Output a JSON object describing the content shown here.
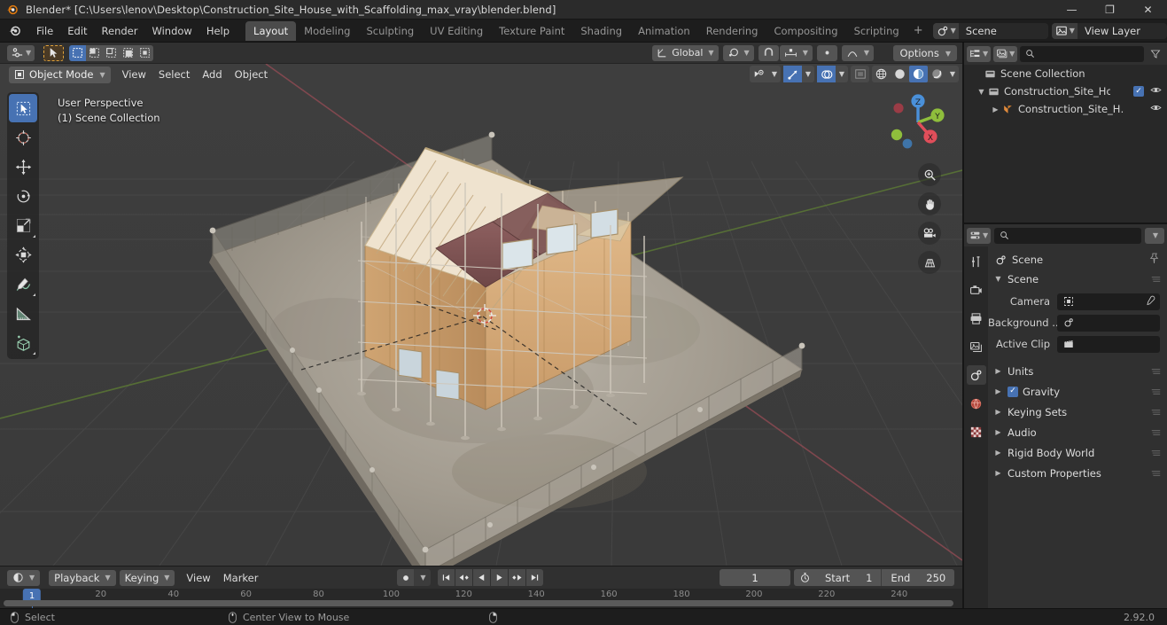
{
  "window": {
    "title": "Blender* [C:\\Users\\lenov\\Desktop\\Construction_Site_House_with_Scaffolding_max_vray\\blender.blend]",
    "minimize": "—",
    "maximize": "❐",
    "close": "✕"
  },
  "topbar": {
    "menus": [
      "File",
      "Edit",
      "Render",
      "Window",
      "Help"
    ],
    "workspaces": [
      {
        "label": "Layout",
        "active": true
      },
      {
        "label": "Modeling",
        "active": false
      },
      {
        "label": "Sculpting",
        "active": false
      },
      {
        "label": "UV Editing",
        "active": false
      },
      {
        "label": "Texture Paint",
        "active": false
      },
      {
        "label": "Shading",
        "active": false
      },
      {
        "label": "Animation",
        "active": false
      },
      {
        "label": "Rendering",
        "active": false
      },
      {
        "label": "Compositing",
        "active": false
      },
      {
        "label": "Scripting",
        "active": false
      }
    ],
    "add_workspace": "+",
    "scene_name": "Scene",
    "view_layer_name": "View Layer"
  },
  "tool_settings": {
    "transform_orientation": "Global",
    "options_label": "Options"
  },
  "viewport": {
    "mode": "Object Mode",
    "menus": [
      "View",
      "Select",
      "Add",
      "Object"
    ],
    "overlay_line1": "User Perspective",
    "overlay_line2": "(1) Scene Collection",
    "gizmo_axes": [
      "Z",
      "Y",
      "X"
    ],
    "tools": [
      {
        "name": "tweak-select-box",
        "active": true
      },
      {
        "name": "cursor",
        "active": false
      },
      {
        "name": "move",
        "active": false
      },
      {
        "name": "rotate",
        "active": false
      },
      {
        "name": "scale",
        "active": false
      },
      {
        "name": "transform",
        "active": false
      },
      {
        "name": "annotate",
        "active": false
      },
      {
        "name": "measure",
        "active": false
      },
      {
        "name": "add-cube",
        "active": false
      }
    ]
  },
  "outliner": {
    "search_placeholder": "",
    "rows": [
      {
        "label": "Scene Collection",
        "depth": 0,
        "icon": "collection",
        "expander": "",
        "eye": false,
        "check": false
      },
      {
        "label": "Construction_Site_House",
        "depth": 1,
        "icon": "collection",
        "expander": "▼",
        "eye": true,
        "check": true
      },
      {
        "label": "Construction_Site_H…",
        "depth": 2,
        "icon": "mesh",
        "expander": "▶",
        "eye": true,
        "check": false
      }
    ]
  },
  "properties": {
    "search_placeholder": "",
    "breadcrumb": "Scene",
    "section_header": "Scene",
    "fields": [
      {
        "label": "Camera",
        "value": "",
        "icon": "camera",
        "eyedropper": true
      },
      {
        "label": "Background ...",
        "value": "",
        "icon": "scene",
        "eyedropper": false
      },
      {
        "label": "Active Clip",
        "value": "",
        "icon": "clip",
        "eyedropper": false
      }
    ],
    "sections": [
      {
        "label": "Units",
        "checkbox": false
      },
      {
        "label": "Gravity",
        "checkbox": true
      },
      {
        "label": "Keying Sets",
        "checkbox": false
      },
      {
        "label": "Audio",
        "checkbox": false
      },
      {
        "label": "Rigid Body World",
        "checkbox": false
      },
      {
        "label": "Custom Properties",
        "checkbox": false
      }
    ],
    "tabs": [
      {
        "name": "tool",
        "active": false
      },
      {
        "name": "render",
        "active": false
      },
      {
        "name": "output",
        "active": false
      },
      {
        "name": "view-layer",
        "active": false
      },
      {
        "name": "scene",
        "active": true
      },
      {
        "name": "world",
        "active": false
      },
      {
        "name": "texture",
        "active": false
      }
    ]
  },
  "timeline": {
    "menus": [
      "View",
      "Marker"
    ],
    "dropdowns": [
      "Playback",
      "Keying"
    ],
    "current_frame": "1",
    "start_label": "Start",
    "start_value": "1",
    "end_label": "End",
    "end_value": "250",
    "ticks": [
      20,
      40,
      60,
      80,
      100,
      120,
      140,
      160,
      180,
      200,
      220,
      240
    ],
    "playhead_label": "1"
  },
  "statusbar": {
    "items": [
      {
        "label": "Select",
        "icon": "mouse-left"
      },
      {
        "label": "Center View to Mouse",
        "icon": "mouse-middle"
      },
      {
        "label": "",
        "icon": "mouse-right"
      }
    ],
    "version": "2.92.0"
  },
  "colors": {
    "accent": "#4772b3",
    "panel": "#303030",
    "dark": "#1d1d1d",
    "axis_x": "#e04e5a",
    "axis_y": "#8fbe3c",
    "axis_z": "#4a90d9"
  }
}
